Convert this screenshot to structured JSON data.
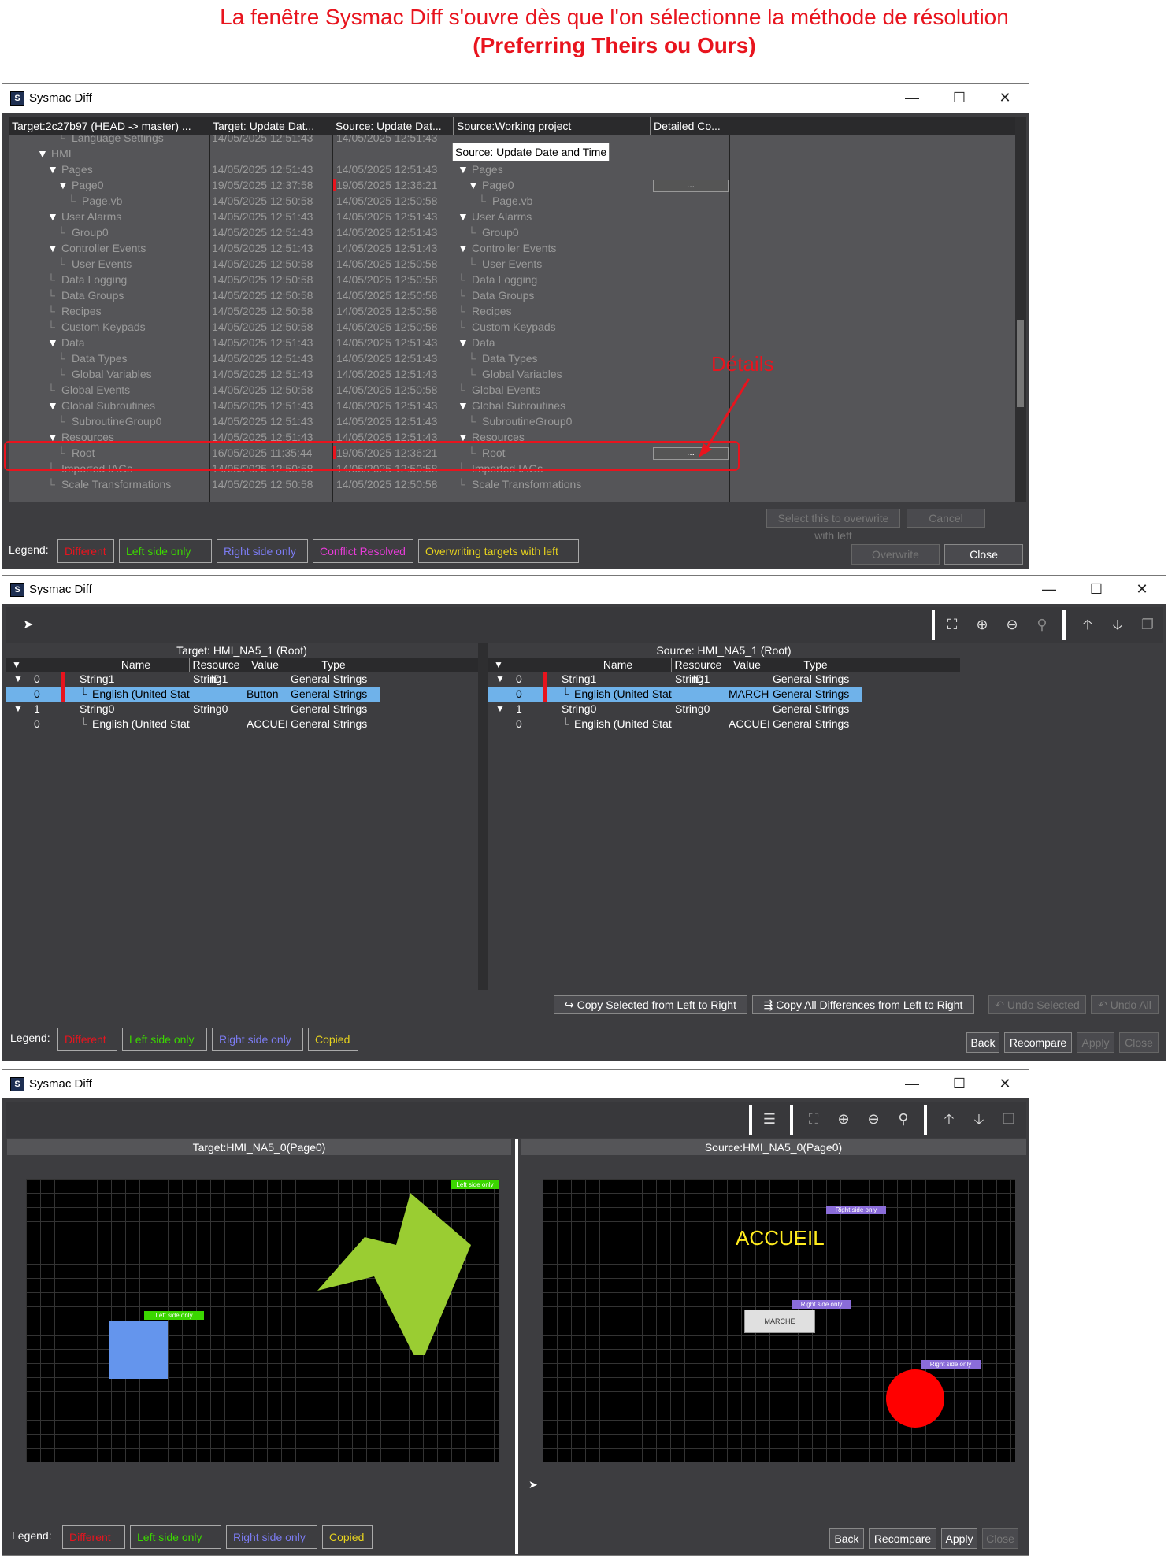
{
  "caption": {
    "line1": "La fenêtre Sysmac Diff s'ouvre dès que l'on sélectionne la méthode de résolution",
    "line2": "(Preferring Theirs ou Ours)"
  },
  "app_title": "Sysmac Diff",
  "window_controls": {
    "minimize": "—",
    "maximize": "☐",
    "close": "✕"
  },
  "win1": {
    "columns": [
      "Target:2c27b97 (HEAD -> master) ...",
      "Target: Update Dat...",
      "Source: Update Dat...",
      "Source:Working project",
      "Detailed Co..."
    ],
    "tooltip": "Source: Update Date and Time",
    "annotation": "Détails",
    "rows": [
      {
        "name": "Language Settings",
        "indent": 4,
        "t": "14/05/2025 12:51:43",
        "s": "14/05/2025 12:51:43",
        "src": "",
        "src_indent": 0,
        "detail": false,
        "mark": false
      },
      {
        "name": "HMI",
        "indent": 2,
        "t": "",
        "s": "",
        "src": "",
        "src_indent": 0,
        "detail": false,
        "mark": false,
        "tri": true
      },
      {
        "name": "Pages",
        "indent": 3,
        "t": "14/05/2025 12:51:43",
        "s": "14/05/2025 12:51:43",
        "src": "Pages",
        "src_indent": 1,
        "detail": false,
        "mark": false,
        "tri": true
      },
      {
        "name": "Page0",
        "indent": 4,
        "t": "19/05/2025 12:37:58",
        "s": "19/05/2025 12:36:21",
        "src": "Page0",
        "src_indent": 2,
        "detail": true,
        "mark": true,
        "tri": true
      },
      {
        "name": "Page.vb",
        "indent": 5,
        "t": "14/05/2025 12:50:58",
        "s": "14/05/2025 12:50:58",
        "src": "Page.vb",
        "src_indent": 3,
        "detail": false,
        "mark": false
      },
      {
        "name": "User Alarms",
        "indent": 3,
        "t": "14/05/2025 12:51:43",
        "s": "14/05/2025 12:51:43",
        "src": "User Alarms",
        "src_indent": 1,
        "detail": false,
        "mark": false,
        "tri": true
      },
      {
        "name": "Group0",
        "indent": 4,
        "t": "14/05/2025 12:51:43",
        "s": "14/05/2025 12:51:43",
        "src": "Group0",
        "src_indent": 2,
        "detail": false,
        "mark": false
      },
      {
        "name": "Controller Events",
        "indent": 3,
        "t": "14/05/2025 12:51:43",
        "s": "14/05/2025 12:51:43",
        "src": "Controller Events",
        "src_indent": 1,
        "detail": false,
        "mark": false,
        "tri": true
      },
      {
        "name": "User Events",
        "indent": 4,
        "t": "14/05/2025 12:50:58",
        "s": "14/05/2025 12:50:58",
        "src": "User Events",
        "src_indent": 2,
        "detail": false,
        "mark": false
      },
      {
        "name": "Data Logging",
        "indent": 3,
        "t": "14/05/2025 12:50:58",
        "s": "14/05/2025 12:50:58",
        "src": "Data Logging",
        "src_indent": 1,
        "detail": false,
        "mark": false
      },
      {
        "name": "Data Groups",
        "indent": 3,
        "t": "14/05/2025 12:50:58",
        "s": "14/05/2025 12:50:58",
        "src": "Data Groups",
        "src_indent": 1,
        "detail": false,
        "mark": false
      },
      {
        "name": "Recipes",
        "indent": 3,
        "t": "14/05/2025 12:50:58",
        "s": "14/05/2025 12:50:58",
        "src": "Recipes",
        "src_indent": 1,
        "detail": false,
        "mark": false
      },
      {
        "name": "Custom Keypads",
        "indent": 3,
        "t": "14/05/2025 12:50:58",
        "s": "14/05/2025 12:50:58",
        "src": "Custom Keypads",
        "src_indent": 1,
        "detail": false,
        "mark": false
      },
      {
        "name": "Data",
        "indent": 3,
        "t": "14/05/2025 12:51:43",
        "s": "14/05/2025 12:51:43",
        "src": "Data",
        "src_indent": 1,
        "detail": false,
        "mark": false,
        "tri": true
      },
      {
        "name": "Data Types",
        "indent": 4,
        "t": "14/05/2025 12:51:43",
        "s": "14/05/2025 12:51:43",
        "src": "Data Types",
        "src_indent": 2,
        "detail": false,
        "mark": false
      },
      {
        "name": "Global Variables",
        "indent": 4,
        "t": "14/05/2025 12:51:43",
        "s": "14/05/2025 12:51:43",
        "src": "Global Variables",
        "src_indent": 2,
        "detail": false,
        "mark": false
      },
      {
        "name": "Global Events",
        "indent": 3,
        "t": "14/05/2025 12:50:58",
        "s": "14/05/2025 12:50:58",
        "src": "Global Events",
        "src_indent": 1,
        "detail": false,
        "mark": false
      },
      {
        "name": "Global Subroutines",
        "indent": 3,
        "t": "14/05/2025 12:51:43",
        "s": "14/05/2025 12:51:43",
        "src": "Global Subroutines",
        "src_indent": 1,
        "detail": false,
        "mark": false,
        "tri": true
      },
      {
        "name": "SubroutineGroup0",
        "indent": 4,
        "t": "14/05/2025 12:51:43",
        "s": "14/05/2025 12:51:43",
        "src": "SubroutineGroup0",
        "src_indent": 2,
        "detail": false,
        "mark": false
      },
      {
        "name": "Resources",
        "indent": 3,
        "t": "14/05/2025 12:51:43",
        "s": "14/05/2025 12:51:43",
        "src": "Resources",
        "src_indent": 1,
        "detail": false,
        "mark": false,
        "tri": true
      },
      {
        "name": "Root",
        "indent": 4,
        "t": "16/05/2025 11:35:44",
        "s": "19/05/2025 12:36:21",
        "src": "Root",
        "src_indent": 2,
        "detail": true,
        "mark": true
      },
      {
        "name": "Imported IAGs",
        "indent": 3,
        "t": "14/05/2025 12:50:58",
        "s": "14/05/2025 12:50:58",
        "src": "Imported IAGs",
        "src_indent": 1,
        "detail": false,
        "mark": false
      },
      {
        "name": "Scale Transformations",
        "indent": 3,
        "t": "14/05/2025 12:50:58",
        "s": "14/05/2025 12:50:58",
        "src": "Scale Transformations",
        "src_indent": 1,
        "detail": false,
        "mark": false
      }
    ],
    "detail_button": "...",
    "buttons": {
      "select_overwrite": "Select this to overwrite with left",
      "cancel": "Cancel",
      "overwrite": "Overwrite",
      "close": "Close"
    },
    "legend_label": "Legend:",
    "legend": [
      {
        "text": "Different",
        "color": "#e8141e"
      },
      {
        "text": "Left side only",
        "color": "#3bd600"
      },
      {
        "text": "Right side only",
        "color": "#7b7bf0"
      },
      {
        "text": "Conflict Resolved",
        "color": "#e83cd8"
      },
      {
        "text": "Overwriting targets with left",
        "color": "#e6d21e"
      }
    ]
  },
  "win2": {
    "target_title": "Target: HMI_NA5_1 (Root)",
    "source_title": "Source: HMI_NA5_1 (Root)",
    "cols": [
      "Name",
      "Resource ID",
      "Value",
      "Type"
    ],
    "left_rows": [
      {
        "idx": "0",
        "name": "String1",
        "rid": "String1",
        "value": "",
        "type": "General Strings",
        "tri": true,
        "diff": true,
        "sel": false,
        "child": false
      },
      {
        "idx": "0",
        "name": "English (United States)",
        "rid": "",
        "value": "Button",
        "type": "General Strings",
        "tri": false,
        "diff": true,
        "sel": true,
        "child": true
      },
      {
        "idx": "1",
        "name": "String0",
        "rid": "String0",
        "value": "",
        "type": "General Strings",
        "tri": true,
        "diff": false,
        "sel": false,
        "child": false
      },
      {
        "idx": "0",
        "name": "English (United States)",
        "rid": "",
        "value": "ACCUEIL",
        "type": "General Strings",
        "tri": false,
        "diff": false,
        "sel": false,
        "child": true
      }
    ],
    "right_rows": [
      {
        "idx": "0",
        "name": "String1",
        "rid": "String1",
        "value": "",
        "type": "General Strings",
        "tri": true,
        "diff": true,
        "sel": false,
        "child": false
      },
      {
        "idx": "0",
        "name": "English (United States)",
        "rid": "",
        "value": "MARCHE",
        "type": "General Strings",
        "tri": false,
        "diff": true,
        "sel": true,
        "child": true
      },
      {
        "idx": "1",
        "name": "String0",
        "rid": "String0",
        "value": "",
        "type": "General Strings",
        "tri": true,
        "diff": false,
        "sel": false,
        "child": false
      },
      {
        "idx": "0",
        "name": "English (United States)",
        "rid": "",
        "value": "ACCUEIL",
        "type": "General Strings",
        "tri": false,
        "diff": false,
        "sel": false,
        "child": true
      }
    ],
    "buttons": {
      "copy_selected": "Copy Selected from Left to Right",
      "copy_all": "Copy All Differences from Left to Right",
      "undo_selected": "Undo Selected",
      "undo_all": "Undo All",
      "back": "Back",
      "recompare": "Recompare",
      "apply": "Apply",
      "close": "Close"
    },
    "legend_label": "Legend:",
    "legend": [
      {
        "text": "Different",
        "color": "#e8141e"
      },
      {
        "text": "Left side only",
        "color": "#3bd600"
      },
      {
        "text": "Right side only",
        "color": "#7b7bf0"
      },
      {
        "text": "Copied",
        "color": "#e6d21e"
      }
    ]
  },
  "win3": {
    "target_title": "Target:HMI_NA5_0(Page0)",
    "source_title": "Source:HMI_NA5_0(Page0)",
    "left_badge": "Left side only",
    "right_badge": "Right side only",
    "accueil": "ACCUEIL",
    "marche": "MARCHE",
    "buttons": {
      "back": "Back",
      "recompare": "Recompare",
      "apply": "Apply",
      "close": "Close"
    },
    "legend_label": "Legend:",
    "legend": [
      {
        "text": "Different",
        "color": "#e8141e"
      },
      {
        "text": "Left side only",
        "color": "#3bd600"
      },
      {
        "text": "Right side only",
        "color": "#7b7bf0"
      },
      {
        "text": "Copied",
        "color": "#e6d21e"
      }
    ]
  }
}
